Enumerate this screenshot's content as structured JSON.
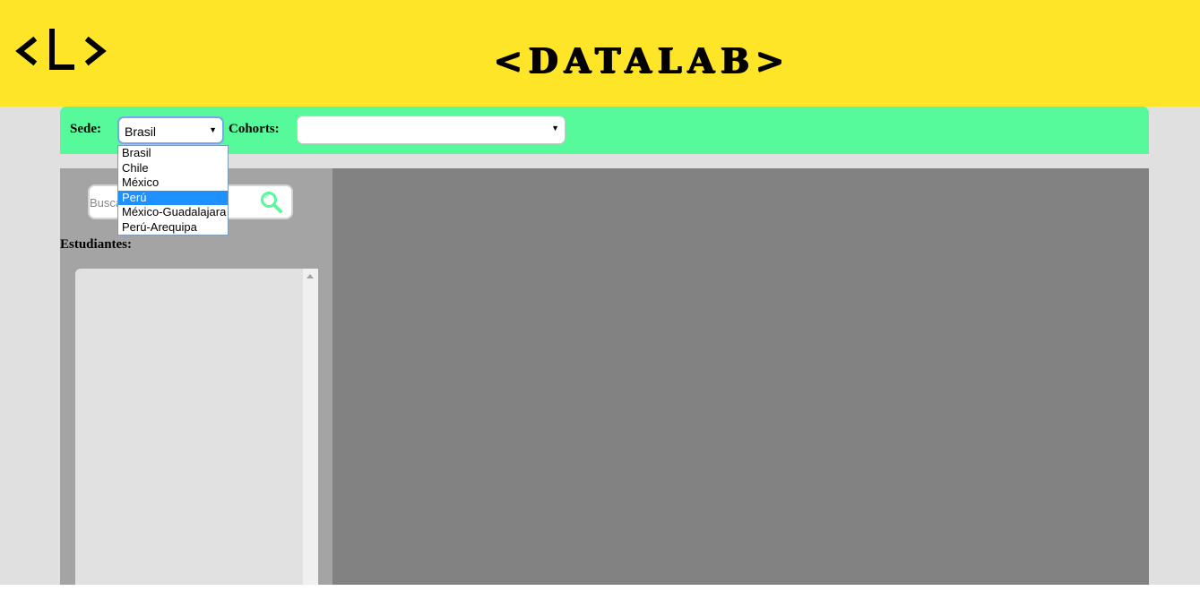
{
  "header": {
    "logo_icon": "code-brackets-L-logo",
    "title": "<DATALAB>",
    "background_color": "#ffe527"
  },
  "filters": {
    "background_color": "#57fa9a",
    "sede_label": "Sede:",
    "sede_value": "Brasil",
    "sede_options": [
      "Brasil",
      "Chile",
      "México",
      "Perú",
      "México-Guadalajara",
      "Perú-Arequipa"
    ],
    "sede_highlighted": "Perú",
    "cohorts_label": "Cohorts:",
    "cohorts_value": ""
  },
  "sidebar": {
    "search_placeholder": "Buscar",
    "search_icon": "magnifier-icon",
    "students_label": "Estudiantes:"
  },
  "colors": {
    "accent": "#57fa9a",
    "brand_yellow": "#ffe527",
    "highlight": "#1e90ff"
  }
}
